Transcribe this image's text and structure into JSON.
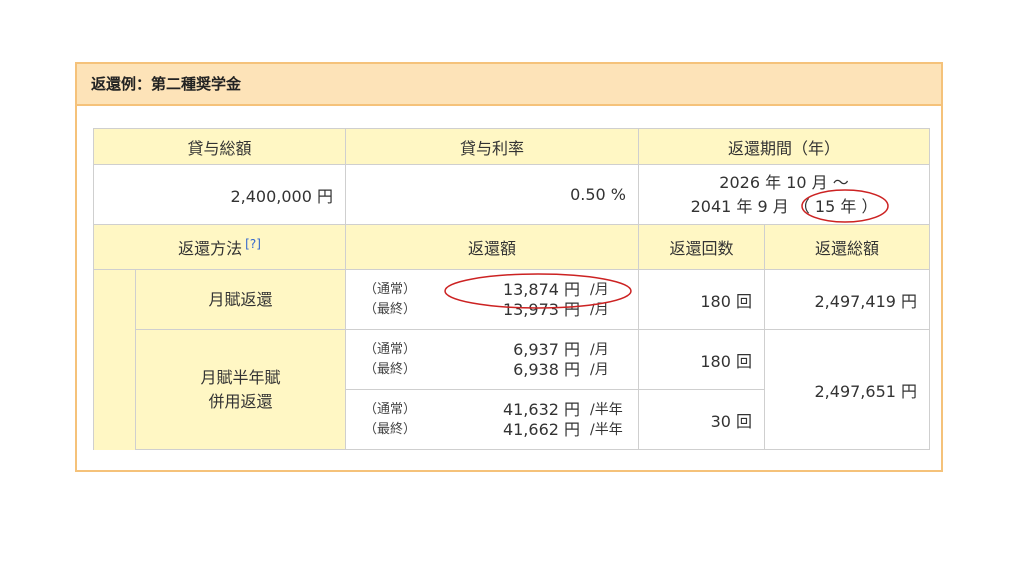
{
  "panel": {
    "title": "返還例：第二種奨学金"
  },
  "loan": {
    "headers": {
      "total": "貸与総額",
      "rate": "貸与利率",
      "period": "返還期間（年）"
    },
    "total": "2,400,000 円",
    "rate": "0.50 %",
    "period_start": "2026 年 10 月 ～",
    "period_end": "2041 年 9 月",
    "period_years": "（ 15 年 ）"
  },
  "repay": {
    "headers": {
      "method": "返還方法",
      "help": "[?]",
      "amount": "返還額",
      "count": "返還回数",
      "total": "返還総額"
    },
    "monthly": {
      "label": "月賦返還",
      "normal_kind": "（通常）",
      "normal_amount": "13,874 円",
      "normal_unit": "/月",
      "final_kind": "（最終）",
      "final_amount": "13,973 円",
      "final_unit": "/月",
      "count": "180 回",
      "total": "2,497,419 円"
    },
    "combined": {
      "label_line1": "月賦半年賦",
      "label_line2": "併用返還",
      "monthly_normal_kind": "（通常）",
      "monthly_normal_amount": "6,937 円",
      "monthly_normal_unit": "/月",
      "monthly_final_kind": "（最終）",
      "monthly_final_amount": "6,938 円",
      "monthly_final_unit": "/月",
      "monthly_count": "180 回",
      "half_normal_kind": "（通常）",
      "half_normal_amount": "41,632 円",
      "half_normal_unit": "/半年",
      "half_final_kind": "（最終）",
      "half_final_amount": "41,662 円",
      "half_final_unit": "/半年",
      "half_count": "30 回",
      "total": "2,497,651 円"
    }
  },
  "annotation_color": "#cc2222"
}
